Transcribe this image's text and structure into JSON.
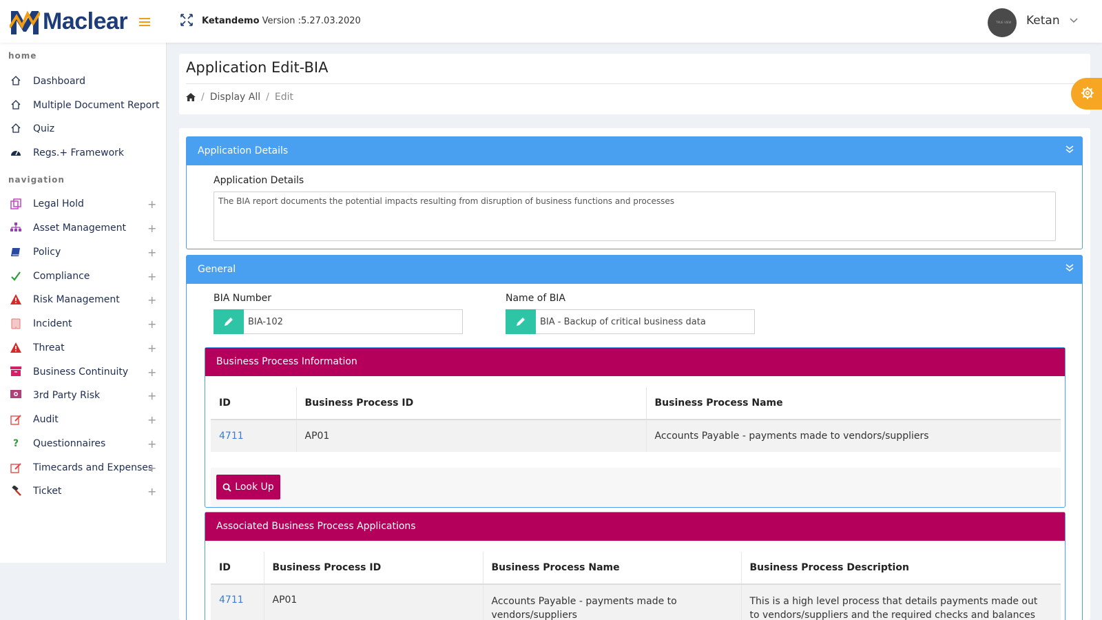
{
  "header": {
    "brand": "Maclear",
    "instance": "Ketandemo",
    "version_label": "Version :5.27.03.2020",
    "user": "Ketan",
    "avatar_text": "TRUE VIEW"
  },
  "sidebar": {
    "home_section": "home",
    "nav_section": "navigation",
    "home_items": [
      {
        "label": "Dashboard",
        "icon": "home-icon"
      },
      {
        "label": "Multiple Document Report",
        "icon": "home-icon"
      },
      {
        "label": "Quiz",
        "icon": "home-icon"
      },
      {
        "label": "Regs.+ Framework",
        "icon": "dashboard-gauge-icon"
      }
    ],
    "nav_items": [
      {
        "label": "Legal Hold",
        "icon": "copy-icon"
      },
      {
        "label": "Asset Management",
        "icon": "sitemap-icon"
      },
      {
        "label": "Policy",
        "icon": "book-icon"
      },
      {
        "label": "Compliance",
        "icon": "check-icon"
      },
      {
        "label": "Risk Management",
        "icon": "warning-icon"
      },
      {
        "label": "Incident",
        "icon": "tablet-icon"
      },
      {
        "label": "Threat",
        "icon": "warning-icon"
      },
      {
        "label": "Business Continuity",
        "icon": "archive-icon"
      },
      {
        "label": "3rd Party Risk",
        "icon": "money-icon"
      },
      {
        "label": "Audit",
        "icon": "edit-icon"
      },
      {
        "label": "Questionnaires",
        "icon": "question-icon"
      },
      {
        "label": "Timecards and Expenses",
        "icon": "edit-icon"
      },
      {
        "label": "Ticket",
        "icon": "gavel-icon"
      }
    ],
    "expand_symbol": "+"
  },
  "page": {
    "title": "Application Edit-BIA",
    "breadcrumb": {
      "display_all": "Display All",
      "current": "Edit",
      "separator": "/"
    }
  },
  "app_details": {
    "panel_title": "Application Details",
    "field_label": "Application Details",
    "text": "The BIA report documents the potential impacts resulting from disruption of business functions and processes"
  },
  "general": {
    "panel_title": "General",
    "bia_number_label": "BIA Number",
    "bia_number": "BIA-102",
    "bia_name_label": "Name of BIA",
    "bia_name": "BIA - Backup of critical business data"
  },
  "business_process_info": {
    "title": "Business Process Information",
    "columns": [
      "ID",
      "Business Process ID",
      "Business Process Name"
    ],
    "rows": [
      {
        "id": "4711",
        "process_id": "AP01",
        "name": "Accounts Payable - payments made to vendors/suppliers"
      }
    ],
    "lookup_label": "Look Up"
  },
  "associated_apps": {
    "title": "Associated Business Process Applications",
    "columns": [
      "ID",
      "Business Process ID",
      "Business Process Name",
      "Business Process Description"
    ],
    "rows": [
      {
        "id": "4711",
        "process_id": "AP01",
        "name": "Accounts Payable - payments made to vendors/suppliers",
        "description": "This is a high level process that details payments made out to vendors/suppliers and the required checks and balances for"
      }
    ]
  },
  "colors": {
    "brand_navy": "#1d3c78",
    "accent_orange": "#f39c12",
    "panel_blue": "#4aa0f0",
    "subpanel_magenta": "#b5005b",
    "addon_teal": "#2ec4a6"
  }
}
